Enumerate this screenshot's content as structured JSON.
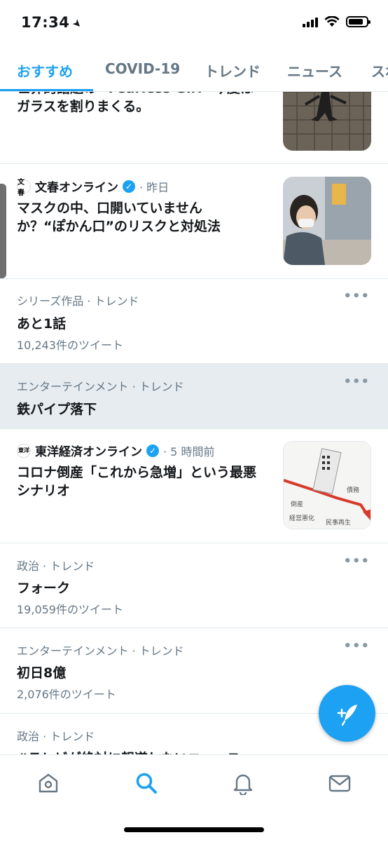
{
  "status_bar": {
    "time": "17:34",
    "location_glyph": "➤"
  },
  "tabs": [
    {
      "label": "おすすめ",
      "active": true
    },
    {
      "label": "COVID-19",
      "active": false
    },
    {
      "label": "トレンド",
      "active": false
    },
    {
      "label": "ニュース",
      "active": false
    },
    {
      "label": "スポ",
      "active": false
    }
  ],
  "feed": {
    "item0": {
      "headline_line1": "世界的話題の \"Fearless Girl\" 今度は",
      "headline_line2": "ガラスを割りまくる。"
    },
    "item1": {
      "publisher": "文春オンライン",
      "logo_text": "文春",
      "time": "· 昨日",
      "headline_line1": "マスクの中、口開いていません",
      "headline_line2": "か？“ぽかん口”のリスクと対処法"
    },
    "item2": {
      "meta": "シリーズ作品 · トレンド",
      "name": "あと1話",
      "tweets": "10,243件のツイート",
      "more": "•••"
    },
    "item3": {
      "meta": "エンターテインメント · トレンド",
      "name": "鉄パイプ落下",
      "more": "•••"
    },
    "item4": {
      "publisher": "東洋経済オンライン",
      "logo_text": "東洋",
      "time": "· 5 時間前",
      "headline_line1": "コロナ倒産「これから急増」という最悪",
      "headline_line2": "シナリオ"
    },
    "item5": {
      "meta": "政治 · トレンド",
      "name": "フォーク",
      "tweets": "19,059件のツイート",
      "more": "•••"
    },
    "item6": {
      "meta": "エンターテインメント · トレンド",
      "name": "初日8億",
      "tweets": "2,076件のツイート",
      "more": "•••"
    },
    "item7": {
      "meta": "政治 · トレンド",
      "name": "#テレビが絶対に報道しないニュース",
      "more": "•••"
    }
  },
  "thumbnail_text": {
    "t1": "倒産",
    "t2": "経営悪化",
    "t3": "民事再生",
    "t4": "債務"
  },
  "nav": {
    "home": "home-icon",
    "search": "search-icon",
    "notifications": "bell-icon",
    "messages": "mail-icon"
  },
  "colors": {
    "accent": "#1da1f2",
    "muted": "#657786",
    "highlight_bg": "#e6ecf0"
  }
}
